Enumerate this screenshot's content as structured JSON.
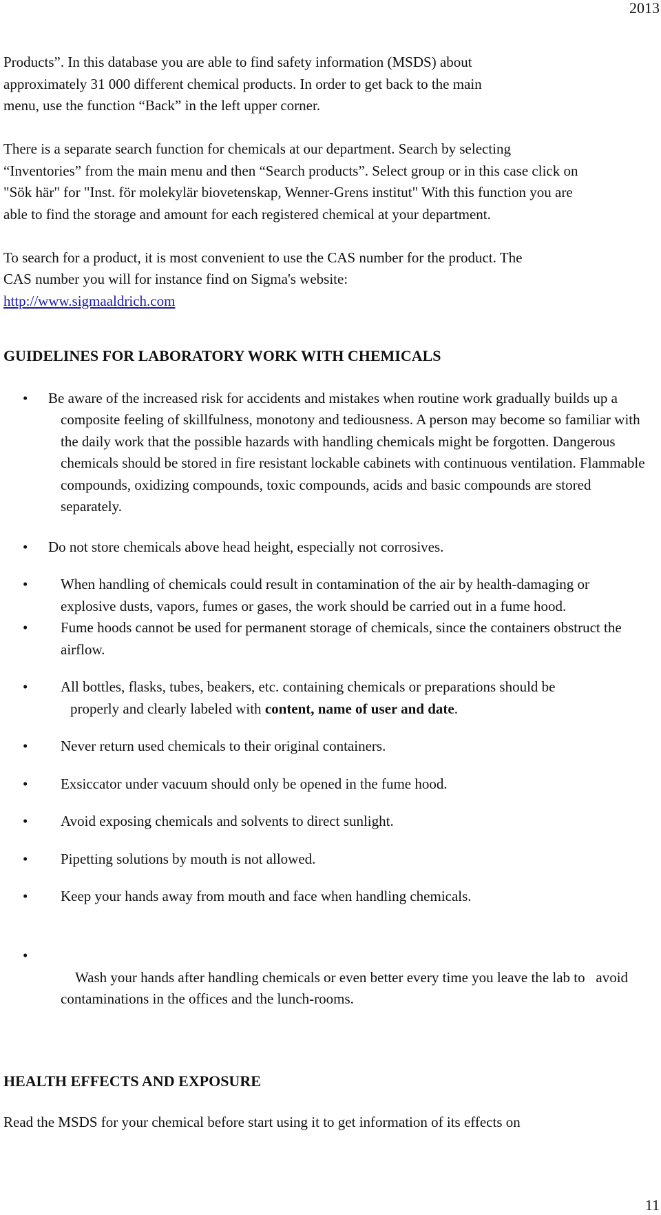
{
  "page": {
    "year": "2013",
    "number": "11"
  },
  "intro": {
    "p1": "Products”. In this database you are able to find safety information (MSDS) about approximately 31 000 different chemical products. In order to get back to the main menu, use the function “Back” in the left upper corner.",
    "p2": "There is a separate search function for chemicals at our department. Search by selecting “Inventories” from the main menu and then “Search products”. Select group or in this case click on \"Sök här\" for \"Inst. för molekylär biovetenskap, Wenner-Grens institut\" With this function you are able to find the storage and amount for each registered chemical at your department.",
    "p3": "To search for a product, it is most convenient to use the CAS number for the product. The CAS number you will for instance find on Sigma's website:",
    "link": "http://www.sigmaaldrich.com"
  },
  "guidelines": {
    "heading": "GUIDELINES FOR LABORATORY WORK WITH CHEMICALS",
    "bullet_symbol": "•",
    "items": [
      "Be aware of the increased risk for accidents and mistakes when routine work gradually builds up a composite feeling of skillfulness, monotony and tediousness. A person may become so familiar with the daily work that the possible hazards with handling chemicals might be forgotten. Dangerous chemicals should be stored in fire resistant lockable cabinets with continuous ventilation. Flammable compounds, oxidizing compounds, toxic compounds, acids and basic compounds are stored separately.",
      "Do not store chemicals above head height, especially not corrosives.",
      "When handling of chemicals could result in contamination of the air by health-damaging or explosive dusts, vapors, fumes or gases, the work should be carried out in a fume hood.",
      "Fume hoods cannot be used for permanent storage of chemicals, since the containers obstruct the airflow.",
      {
        "line1": "All bottles, flasks, tubes, beakers, etc. containing chemicals or preparations should be",
        "line2_prefix": "properly and clearly labeled with ",
        "line2_bold": "content, name of user and date",
        "line2_suffix": "."
      },
      "Never return used chemicals to their original containers.",
      "Exsiccator under vacuum should only be opened in the fume hood.",
      "Avoid exposing chemicals and solvents to direct sunlight.",
      "Pipetting solutions by mouth is not allowed.",
      "Keep your hands away from mouth and face when handling chemicals.",
      "Wash your hands after handling chemicals or even better every time you leave the lab to   avoid contaminations in the offices and the lunch-rooms."
    ]
  },
  "health": {
    "heading": "HEALTH EFFECTS AND EXPOSURE",
    "p1": "Read the MSDS for your chemical before start using it to get information of its effects on"
  }
}
